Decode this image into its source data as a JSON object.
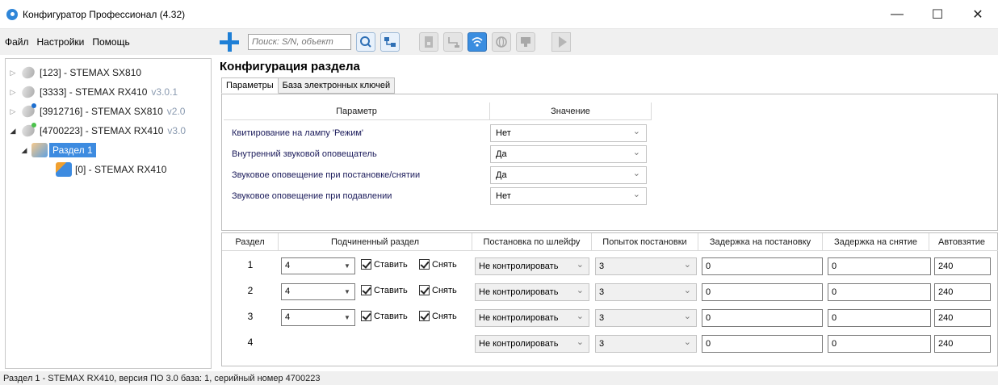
{
  "window": {
    "title": "Конфигуратор Профессионал (4.32)",
    "minimize": "—",
    "maximize": "☐",
    "close": "✕"
  },
  "menu": [
    "Файл",
    "Настройки",
    "Помощь"
  ],
  "toolbar": {
    "search_placeholder": "Поиск: S/N, объект"
  },
  "tree": [
    {
      "label": "[123] - STEMAX SX810",
      "version": ""
    },
    {
      "label": "[3333] - STEMAX RX410",
      "version": "v3.0.1"
    },
    {
      "label": "[3912716] - STEMAX SX810",
      "version": "v2.0"
    },
    {
      "label": "[4700223] - STEMAX RX410",
      "version": "v3.0"
    },
    {
      "label": "Раздел 1",
      "version": ""
    },
    {
      "label": "[0] - STEMAX RX410",
      "version": ""
    }
  ],
  "panel": {
    "title": "Конфигурация раздела",
    "tabs": [
      "Параметры",
      "База электронных ключей"
    ],
    "param_headers": [
      "Параметр",
      "Значение"
    ],
    "params": [
      {
        "label": "Квитирование на лампу 'Режим'",
        "value": "Нет"
      },
      {
        "label": "Внутренний звуковой оповещатель",
        "value": "Да"
      },
      {
        "label": "Звуковое оповещение при постановке/снятии",
        "value": "Да"
      },
      {
        "label": "Звуковое оповещение при подавлении",
        "value": "Нет"
      }
    ]
  },
  "grid": {
    "headers": [
      "Раздел",
      "Подчиненный раздел",
      "Постановка по шлейфу",
      "Попыток постановки",
      "Задержка на постановку",
      "Задержка на снятие",
      "Автовзятие"
    ],
    "arm_label": "Ставить",
    "disarm_label": "Снять",
    "rows": [
      {
        "num": "1",
        "sub": "4",
        "loop": "Не контролировать",
        "attempts": "3",
        "arm_delay": "0",
        "disarm_delay": "0",
        "auto": "240"
      },
      {
        "num": "2",
        "sub": "4",
        "loop": "Не контролировать",
        "attempts": "3",
        "arm_delay": "0",
        "disarm_delay": "0",
        "auto": "240"
      },
      {
        "num": "3",
        "sub": "4",
        "loop": "Не контролировать",
        "attempts": "3",
        "arm_delay": "0",
        "disarm_delay": "0",
        "auto": "240"
      },
      {
        "num": "4",
        "sub": "",
        "loop": "Не контролировать",
        "attempts": "3",
        "arm_delay": "0",
        "disarm_delay": "0",
        "auto": "240"
      }
    ]
  },
  "status": "Раздел 1 - STEMAX RX410, версия ПО 3.0 база: 1, серийный номер 4700223",
  "colors": {
    "accent": "#3d8be0",
    "status_dot_blue": "#1e6fd0",
    "status_dot_green": "#4cc24c"
  }
}
